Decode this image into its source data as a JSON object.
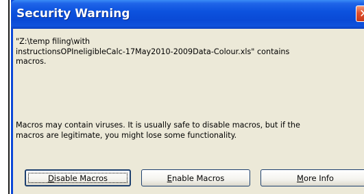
{
  "window": {
    "title": "Security Warning",
    "close_glyph": "✕"
  },
  "message": {
    "line1": "\"Z:\\temp filing\\with",
    "line2": "instructionsOPIneligibleCalc-17May2010-2009Data-Colour.xls\" contains",
    "line3": "macros.",
    "warning_line1": "Macros may contain viruses. It is usually safe to disable macros, but if the",
    "warning_line2": "macros are legitimate, you might lose some functionality."
  },
  "buttons": {
    "disable": {
      "accel": "D",
      "rest": "isable Macros"
    },
    "enable": {
      "accel": "E",
      "rest": "nable Macros"
    },
    "more_info": {
      "accel": "M",
      "rest": "ore Info"
    }
  },
  "icons": {
    "close": "close-icon"
  },
  "colors": {
    "titlebar": "#0a4ad6",
    "close_button": "#e0502c",
    "client_background": "#ece9d8"
  }
}
